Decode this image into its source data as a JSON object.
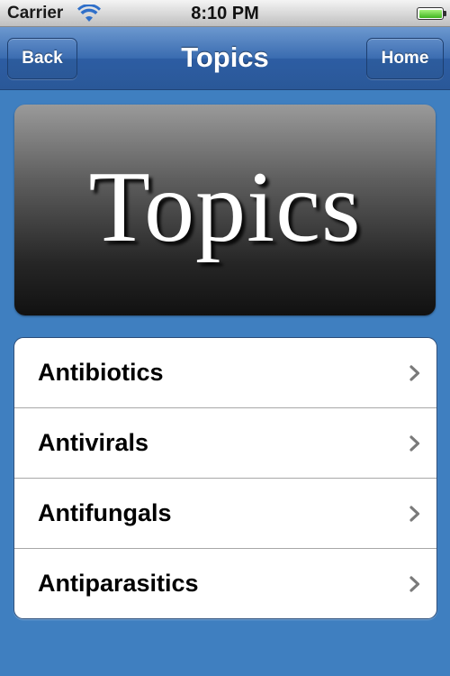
{
  "status_bar": {
    "carrier": "Carrier",
    "time": "8:10 PM",
    "wifi_icon": "wifi-icon",
    "battery_icon": "battery-icon",
    "battery_level": 1.0,
    "battery_color": "#3fb51f"
  },
  "nav_bar": {
    "title": "Topics",
    "back_label": "Back",
    "home_label": "Home",
    "color": "#3a6cb0"
  },
  "banner": {
    "text": "Topics"
  },
  "topics": {
    "items": [
      {
        "label": "Antibiotics",
        "icon": "chevron-right-icon"
      },
      {
        "label": "Antivirals",
        "icon": "chevron-right-icon"
      },
      {
        "label": "Antifungals",
        "icon": "chevron-right-icon"
      },
      {
        "label": "Antiparasitics",
        "icon": "chevron-right-icon"
      }
    ]
  },
  "colors": {
    "background": "#3f7fc0",
    "list_background": "#ffffff"
  }
}
